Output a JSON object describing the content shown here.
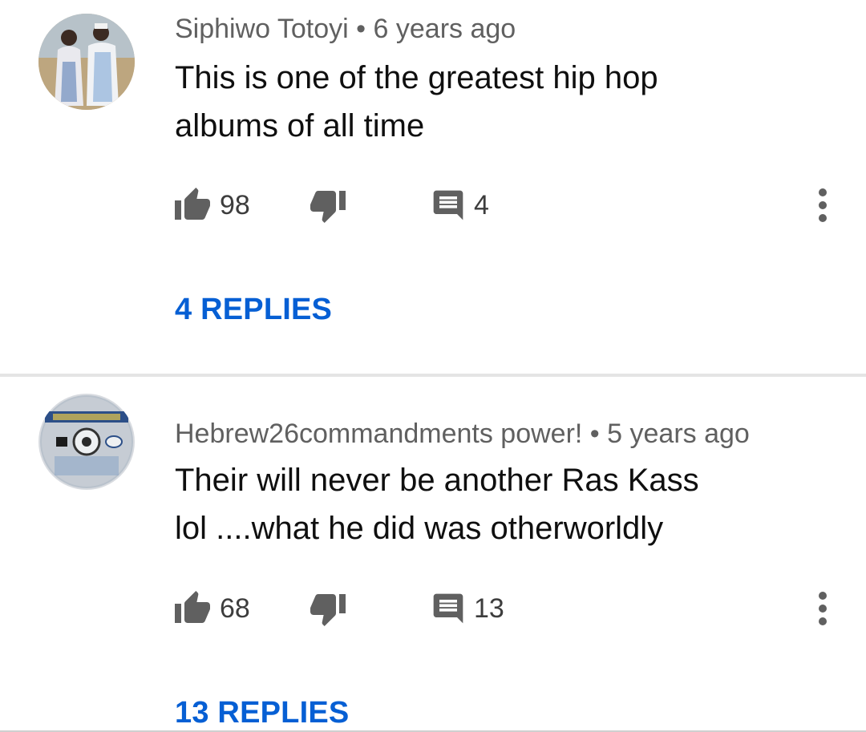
{
  "comments": [
    {
      "author": "Siphiwo Totoyi",
      "separator": "•",
      "time": "6 years ago",
      "text_line1": "This is one of the greatest hip hop",
      "text_line2": "albums of all time",
      "likes": "98",
      "reply_count": "4",
      "replies_label": "4 REPLIES",
      "avatar_icon": "avatar-photo-couple"
    },
    {
      "author": "Hebrew26commandments power!",
      "separator": "•",
      "time": "5 years ago",
      "text_line1": "Their will never be another Ras Kass",
      "text_line2": "lol ....what he did was otherworldly",
      "likes": "68",
      "reply_count": "13",
      "replies_label": "13 REPLIES",
      "avatar_icon": "avatar-game-disc"
    }
  ],
  "icons": {
    "like": "thumbs-up-icon",
    "dislike": "thumbs-down-icon",
    "reply": "comment-icon",
    "more": "more-vert-icon"
  },
  "colors": {
    "link": "#065fd4",
    "meta": "#606060",
    "text": "#0f0f0f",
    "icon": "#606060"
  }
}
